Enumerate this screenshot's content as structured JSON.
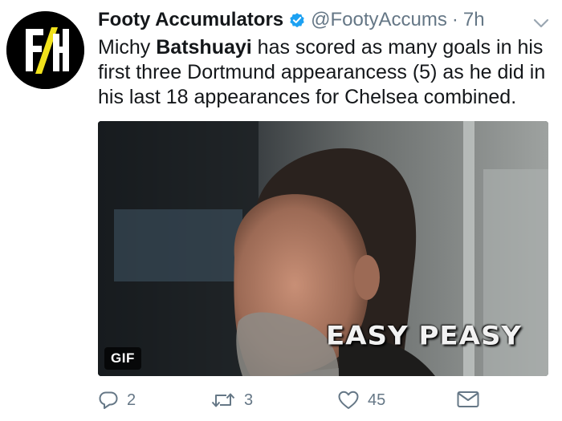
{
  "account": {
    "name": "Footy Accumulators",
    "handle": "@FootyAccums",
    "separator": "·",
    "time": "7h",
    "verified": true,
    "avatar_logo": "FA"
  },
  "tweet": {
    "text_before": "Michy ",
    "text_bold": "Batshuayi",
    "text_after": " has scored as many goals in his first three Dortmund appearancess (5) as he did in his last 18 appearances for Chelsea combined."
  },
  "media": {
    "badge": "GIF",
    "caption": "EASY PEASY"
  },
  "actions": {
    "reply_count": "2",
    "retweet_count": "3",
    "like_count": "45"
  },
  "icons": {
    "verified": "verified-badge-icon",
    "caret": "chevron-down-icon",
    "reply": "reply-icon",
    "retweet": "retweet-icon",
    "like": "heart-icon",
    "dm": "envelope-icon"
  },
  "colors": {
    "verified_blue": "#1da1f2",
    "secondary_text": "#657786",
    "logo_yellow": "#f1e21c"
  }
}
